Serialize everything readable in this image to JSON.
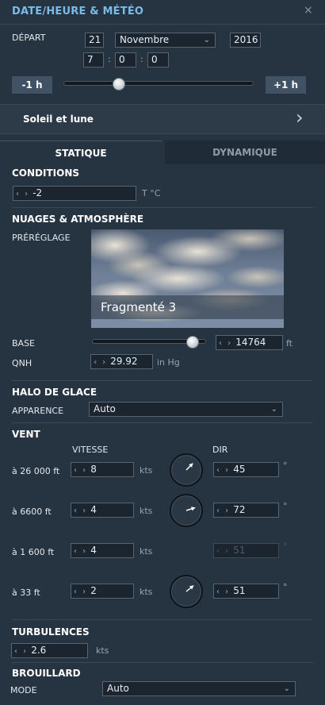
{
  "window": {
    "title": "DATE/HEURE & MÉTÉO",
    "close_glyph": "×"
  },
  "depart": {
    "label": "DÉPART",
    "day": "21",
    "month": "Novembre",
    "year": "2016",
    "hour": "7",
    "minute": "0",
    "second": "0",
    "sep": ":",
    "minus_label": "-1 h",
    "plus_label": "+1 h",
    "slider_fraction": 0.29
  },
  "soleil": {
    "label": "Soleil et lune",
    "chevron": "›"
  },
  "tabs": [
    {
      "label": "STATIQUE",
      "active": true
    },
    {
      "label": "DYNAMIQUE",
      "active": false
    }
  ],
  "conditions": {
    "title": "CONDITIONS",
    "temp_value": "-2",
    "temp_unit": "T °C"
  },
  "nuages": {
    "title": "NUAGES & ATMOSPHÈRE",
    "preset_label": "PRÉRÉGLAGE",
    "preset_name": "Fragmenté 3",
    "base_label": "BASE",
    "base_value": "14764",
    "base_unit": "ft",
    "base_slider_fraction": 0.88,
    "qnh_label": "QNH",
    "qnh_value": "29.92",
    "qnh_unit": "in Hg"
  },
  "halo": {
    "title": "HALO DE GLACE",
    "apparence_label": "APPARENCE",
    "apparence_value": "Auto"
  },
  "vent": {
    "title": "VENT",
    "vitesse_header": "VITESSE",
    "dir_header": "DIR",
    "speed_unit": "kts",
    "dir_unit": "°",
    "rows": [
      {
        "altitude": "à 26 000 ft",
        "speed": "8",
        "dir": "45",
        "dial": true,
        "dir_enabled": true
      },
      {
        "altitude": "à 6600 ft",
        "speed": "4",
        "dir": "72",
        "dial": true,
        "dir_enabled": true
      },
      {
        "altitude": "à 1 600 ft",
        "speed": "4",
        "dir": "51",
        "dial": false,
        "dir_enabled": false
      },
      {
        "altitude": "à 33 ft",
        "speed": "2",
        "dir": "51",
        "dial": true,
        "dir_enabled": true
      }
    ]
  },
  "turbulences": {
    "title": "TURBULENCES",
    "value": "2.6",
    "unit": "kts"
  },
  "brouillard": {
    "title": "BROUILLARD",
    "mode_label": "MODE",
    "mode_value": "Auto"
  },
  "icons": {
    "spinner_arrows": "‹ ›",
    "dropdown": "⌄"
  },
  "colors": {
    "background": "#263340",
    "title_accent": "#7bbbe8",
    "button": "#405264"
  }
}
